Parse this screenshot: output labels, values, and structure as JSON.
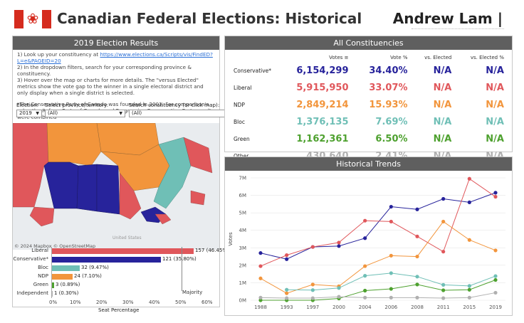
{
  "header": {
    "title": "Canadian Federal Elections: Historical",
    "author": "Andrew Lam |"
  },
  "left_panel": {
    "title": "2019 Election Results",
    "instructions": {
      "line1_prefix": "1) Look up your constituency at ",
      "line1_link": "https://www.elections.ca/Scripts/vis/FindED?L=e&PAGEID=20",
      "line2": "2) In the dropdown filters, search for your corresponding province & constituency.",
      "line3": "3) Hover over the map or charts for more details. The \"versus Elected\" metrics show the vote gap to the winner in a single electoral district and only display when a single district is selected.",
      "note": "*The Conservative Party of Canada was founded in 2003. For comparison's sake, the Reform Party of Canada and Progressive Conservative Party results were combined"
    },
    "filters": {
      "election_label": "Election:",
      "election_value": "2019",
      "province_label": "Select province/territory:",
      "province_value": "(All)",
      "constituency_label": "Search constituency (or click map):",
      "constituency_value": "(All)"
    },
    "map_credit": "© 2024 Mapbox © OpenStreetMap",
    "map_label": "United States",
    "seat_chart": {
      "rows": [
        {
          "party": "Liberal",
          "label": "157 (46.45%)",
          "color": "#e0575b"
        },
        {
          "party": "Conservative*",
          "label": "121 (35.80%)",
          "color": "#27239b"
        },
        {
          "party": "Bloc",
          "label": "32 (9.47%)",
          "color": "#6fbfb6"
        },
        {
          "party": "NDP",
          "label": "24 (7.10%)",
          "color": "#f2953c"
        },
        {
          "party": "Green",
          "label": "3 (0.89%)",
          "color": "#4ea12f"
        },
        {
          "party": "Independent",
          "label": "1 (0.30%)",
          "color": "#b0b0b0"
        }
      ],
      "majority_label": "Majority",
      "x_ticks": [
        "0%",
        "10%",
        "20%",
        "30%",
        "40%",
        "50%",
        "60%"
      ],
      "xlabel": "Seat Percentage"
    }
  },
  "constituencies": {
    "title": "All Constituencies",
    "columns": [
      "Votes",
      "Vote %",
      "vs. Elected",
      "vs. Elected %"
    ],
    "rows": [
      {
        "party": "Conservative*",
        "votes": "6,154,299",
        "pct": "34.40%",
        "vs": "N/A",
        "vsp": "N/A",
        "color": "#27239b"
      },
      {
        "party": "Liberal",
        "votes": "5,915,950",
        "pct": "33.07%",
        "vs": "N/A",
        "vsp": "N/A",
        "color": "#e0575b"
      },
      {
        "party": "NDP",
        "votes": "2,849,214",
        "pct": "15.93%",
        "vs": "N/A",
        "vsp": "N/A",
        "color": "#f2953c"
      },
      {
        "party": "Bloc",
        "votes": "1,376,135",
        "pct": "7.69%",
        "vs": "N/A",
        "vsp": "N/A",
        "color": "#6fbfb6"
      },
      {
        "party": "Green",
        "votes": "1,162,361",
        "pct": "6.50%",
        "vs": "N/A",
        "vsp": "N/A",
        "color": "#4ea12f"
      },
      {
        "party": "Other",
        "votes": "430,640",
        "pct": "2.41%",
        "vs": "N/A",
        "vsp": "N/A",
        "color": "#b0b0b0"
      }
    ]
  },
  "trends": {
    "title": "Historical Trends",
    "ylabel": "Votes",
    "chart_data": {
      "type": "line",
      "x": [
        "1988",
        "1993",
        "1997",
        "2000",
        "2004",
        "2006",
        "2008",
        "2011",
        "2015",
        "2019"
      ],
      "y_ticks": [
        "0M",
        "1M",
        "2M",
        "3M",
        "4M",
        "5M",
        "6M",
        "7M"
      ],
      "ylim": [
        0,
        7000000
      ],
      "ylabel": "Votes",
      "grid": true,
      "series": [
        {
          "name": "Conservative*",
          "color": "#27239b",
          "values": [
            2700000,
            2350000,
            3050000,
            3100000,
            3550000,
            5350000,
            5200000,
            5800000,
            5600000,
            6150000
          ]
        },
        {
          "name": "Liberal",
          "color": "#e0575b",
          "values": [
            1950000,
            2580000,
            3050000,
            3300000,
            4550000,
            4500000,
            3650000,
            2780000,
            6950000,
            5920000
          ]
        },
        {
          "name": "NDP",
          "color": "#f2953c",
          "values": [
            1250000,
            400000,
            900000,
            800000,
            1950000,
            2550000,
            2500000,
            4500000,
            3450000,
            2850000
          ]
        },
        {
          "name": "Bloc",
          "color": "#6fbfb6",
          "values": [
            null,
            600000,
            580000,
            700000,
            1400000,
            1550000,
            1350000,
            880000,
            820000,
            1380000
          ]
        },
        {
          "name": "Green",
          "color": "#4ea12f",
          "values": [
            0,
            0,
            0,
            100000,
            550000,
            650000,
            900000,
            570000,
            600000,
            1160000
          ]
        },
        {
          "name": "Other",
          "color": "#b0b0b0",
          "values": [
            150000,
            120000,
            120000,
            200000,
            150000,
            150000,
            150000,
            120000,
            150000,
            430000
          ]
        }
      ]
    }
  }
}
